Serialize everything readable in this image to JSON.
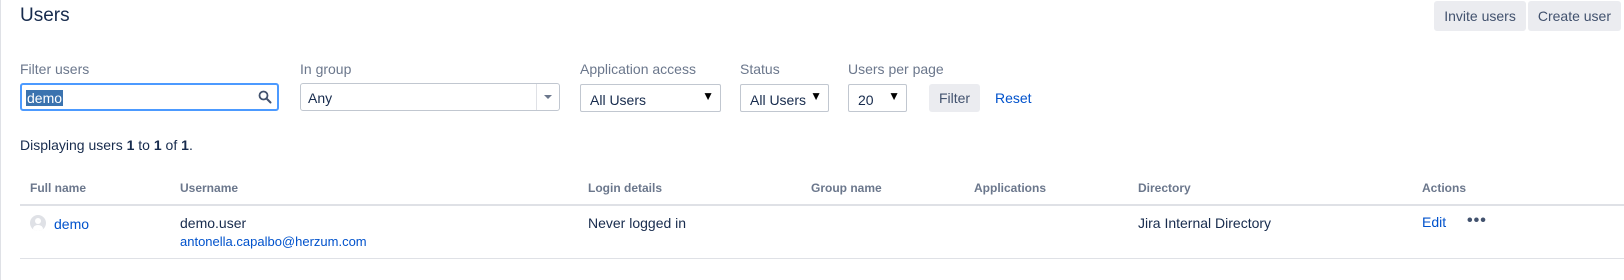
{
  "page": {
    "title": "Users"
  },
  "actions": {
    "invite_users": "Invite users",
    "create_user": "Create user"
  },
  "filters": {
    "filter_users": {
      "label": "Filter users",
      "value": "demo"
    },
    "in_group": {
      "label": "In group",
      "value": "Any"
    },
    "application_access": {
      "label": "Application access",
      "value": "All Users"
    },
    "status": {
      "label": "Status",
      "value": "All Users"
    },
    "users_per_page": {
      "label": "Users per page",
      "value": "20"
    },
    "filter_button": "Filter",
    "reset_link": "Reset"
  },
  "summary": {
    "prefix": "Displaying users ",
    "from": "1",
    "to_word": " to ",
    "to": "1",
    "of_word": " of ",
    "total": "1",
    "suffix": "."
  },
  "table": {
    "columns": [
      "Full name",
      "Username",
      "Login details",
      "Group name",
      "Applications",
      "Directory",
      "Actions"
    ],
    "rows": [
      {
        "full_name": "demo",
        "username": "demo.user",
        "email": "antonella.capalbo@herzum.com",
        "login_details": "Never logged in",
        "group_name": "",
        "applications": "",
        "directory": "Jira Internal Directory",
        "edit": "Edit",
        "more": "•••"
      }
    ]
  },
  "colors": {
    "link": "#0052cc",
    "focus_border": "#4c9aff",
    "selection": "#3b73af"
  },
  "icons": [
    "search-icon",
    "chevron-down-icon",
    "avatar-icon",
    "more-icon"
  ]
}
